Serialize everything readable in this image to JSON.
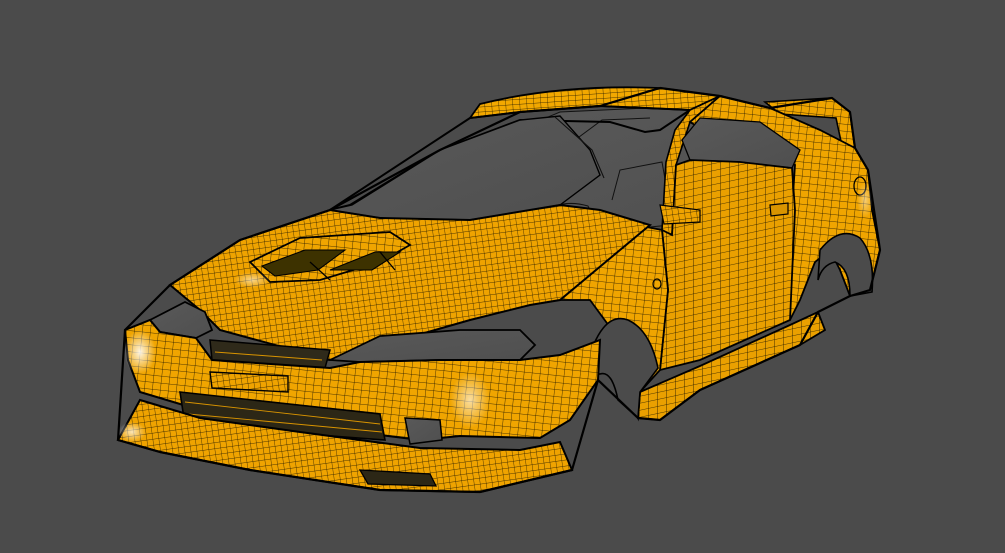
{
  "viewport": {
    "background": "#4b4b4b",
    "render_mode": "wireframe-on-shaded",
    "model": {
      "subject": "car-body-shell",
      "surface_color": "#f0a400",
      "wire_color": "#1a1200",
      "edge_color": "#000000",
      "highlight_color": "#ffffff",
      "glass_tint": "#6a6a6a"
    }
  }
}
